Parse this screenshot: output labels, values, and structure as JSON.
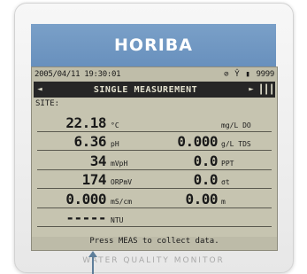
{
  "device": {
    "brand": "HORIBA",
    "model_label": "WATER QUALITY MONITOR"
  },
  "status": {
    "datetime": "2005/04/11 19:30:01",
    "icons": [
      "link-icon",
      "antenna-icon",
      "battery-icon"
    ],
    "memory": "9999"
  },
  "mode": {
    "prev_arrow": "◄",
    "label": "SINGLE MEASUREMENT",
    "next_arrow": "►"
  },
  "site_label": "SITE:",
  "readings": [
    {
      "left_value": "22.18",
      "left_unit": "°C",
      "right_value": "",
      "right_unit": "mg/L DO"
    },
    {
      "left_value": "6.36",
      "left_unit": "pH",
      "right_value": "0.000",
      "right_unit": "g/L TDS"
    },
    {
      "left_value": "34",
      "left_unit": "mVpH",
      "right_value": "0.0",
      "right_unit": "PPT"
    },
    {
      "left_value": "174",
      "left_unit": "ORPmV",
      "right_value": "0.0",
      "right_unit": "σt"
    },
    {
      "left_value": "0.000",
      "left_unit": "mS/cm",
      "right_value": "0.00",
      "right_unit": "m"
    },
    {
      "left_value": "-----",
      "left_unit": "NTU",
      "right_value": "",
      "right_unit": ""
    }
  ],
  "message": "Press MEAS to collect data.",
  "colors": {
    "brand_band": "#7199c4",
    "lcd_background": "#c6c4b0",
    "lcd_text": "#1a1a1a"
  }
}
